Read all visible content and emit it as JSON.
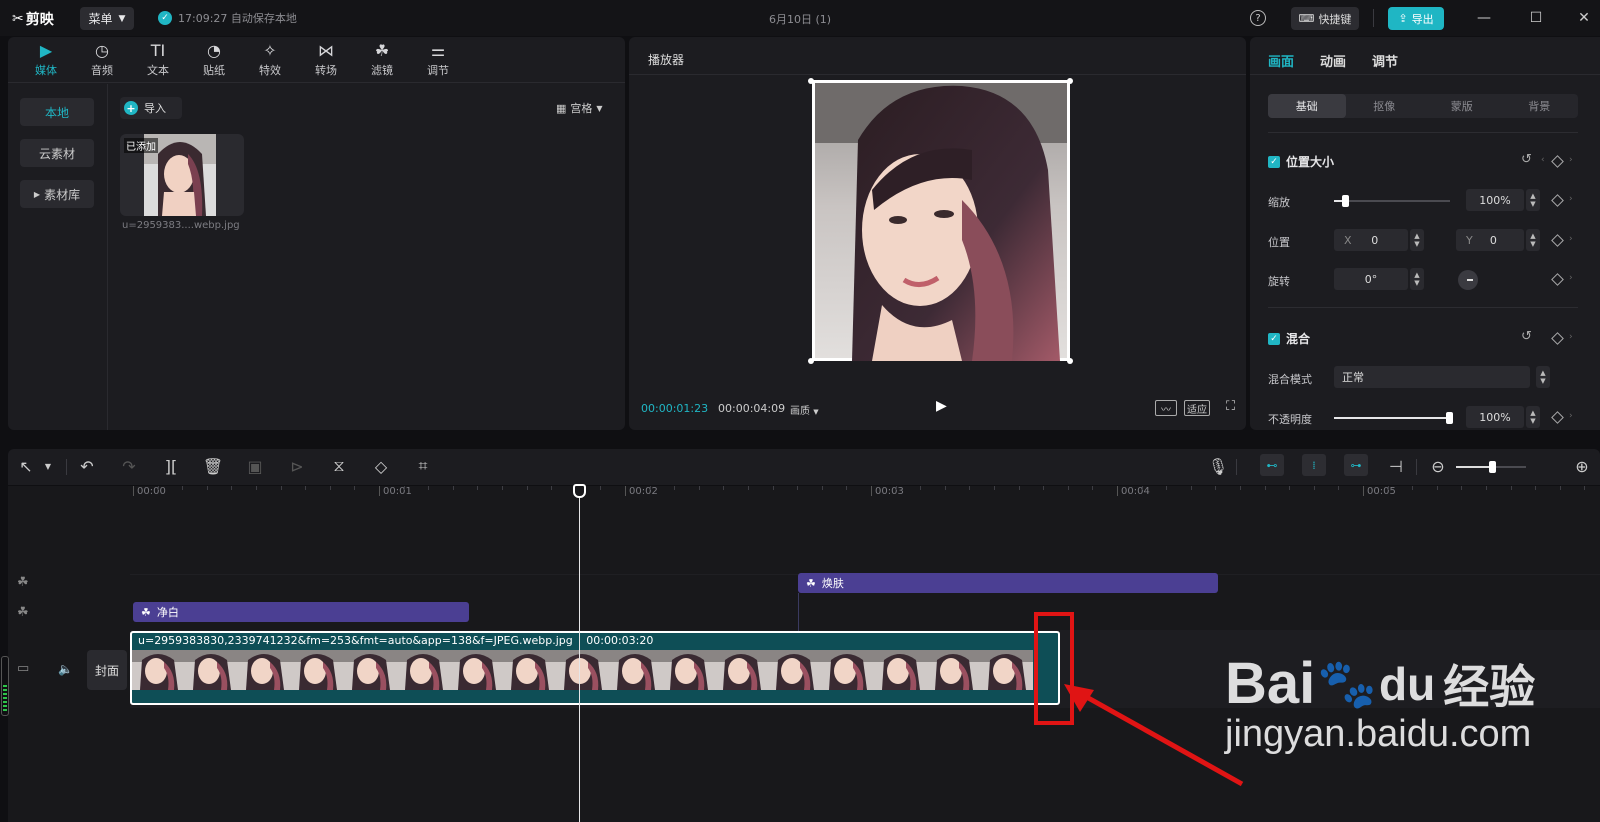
{
  "titlebar": {
    "app_name": "剪映",
    "menu_label": "菜单",
    "autosave_text": "17:09:27 自动保存本地",
    "doc_title": "6月10日 (1)",
    "shortcut_label": "快捷键",
    "export_label": "导出"
  },
  "media_tabs": [
    {
      "label": "媒体",
      "icon": "media-icon",
      "active": true
    },
    {
      "label": "音频",
      "icon": "audio-icon"
    },
    {
      "label": "文本",
      "icon": "text-icon"
    },
    {
      "label": "贴纸",
      "icon": "sticker-icon"
    },
    {
      "label": "特效",
      "icon": "effects-icon"
    },
    {
      "label": "转场",
      "icon": "transition-icon"
    },
    {
      "label": "滤镜",
      "icon": "filter-icon"
    },
    {
      "label": "调节",
      "icon": "adjust-icon"
    }
  ],
  "media_sidebar": {
    "local": "本地",
    "cloud": "云素材",
    "library": "素材库"
  },
  "media_area": {
    "import_label": "导入",
    "view_label": "宫格",
    "added_badge": "已添加",
    "file_name": "u=2959383....webp.jpg"
  },
  "player": {
    "title": "播放器",
    "current_time": "00:00:01:23",
    "total_time": "00:00:04:09",
    "quality_label": "画质",
    "fit_label": "适应"
  },
  "properties": {
    "tabs": [
      "画面",
      "动画",
      "调节"
    ],
    "subtabs": [
      "基础",
      "抠像",
      "蒙版",
      "背景"
    ],
    "position_section": "位置大小",
    "scale_label": "缩放",
    "scale_value": "100%",
    "scale_level": 0.1,
    "position_label": "位置",
    "x_label": "X",
    "x_value": "0",
    "y_label": "Y",
    "y_value": "0",
    "rotate_label": "旋转",
    "rotate_value": "0°",
    "blend_section": "混合",
    "blend_mode_label": "混合模式",
    "blend_mode_value": "正常",
    "opacity_label": "不透明度",
    "opacity_value": "100%",
    "opacity_level": 1.0
  },
  "timeline": {
    "ruler": [
      "00:00",
      "00:01",
      "00:02",
      "00:03",
      "00:04",
      "00:05"
    ],
    "fx_clip_1": "焕肤",
    "fx_clip_2": "净白",
    "main_clip_name": "u=2959383830,2339741232&fm=253&fmt=auto&app=138&f=JPEG.webp.jpg",
    "main_clip_duration": "00:00:03:20",
    "cover_label": "封面"
  },
  "watermark": {
    "brand": "Bai",
    "brand2": "du",
    "suffix": "经验",
    "url": "jingyan.baidu.com"
  },
  "colors": {
    "accent": "#20b6c4",
    "fx_clip": "#4b3f93",
    "main_clip": "#0e4e56",
    "highlight": "#e01414"
  }
}
